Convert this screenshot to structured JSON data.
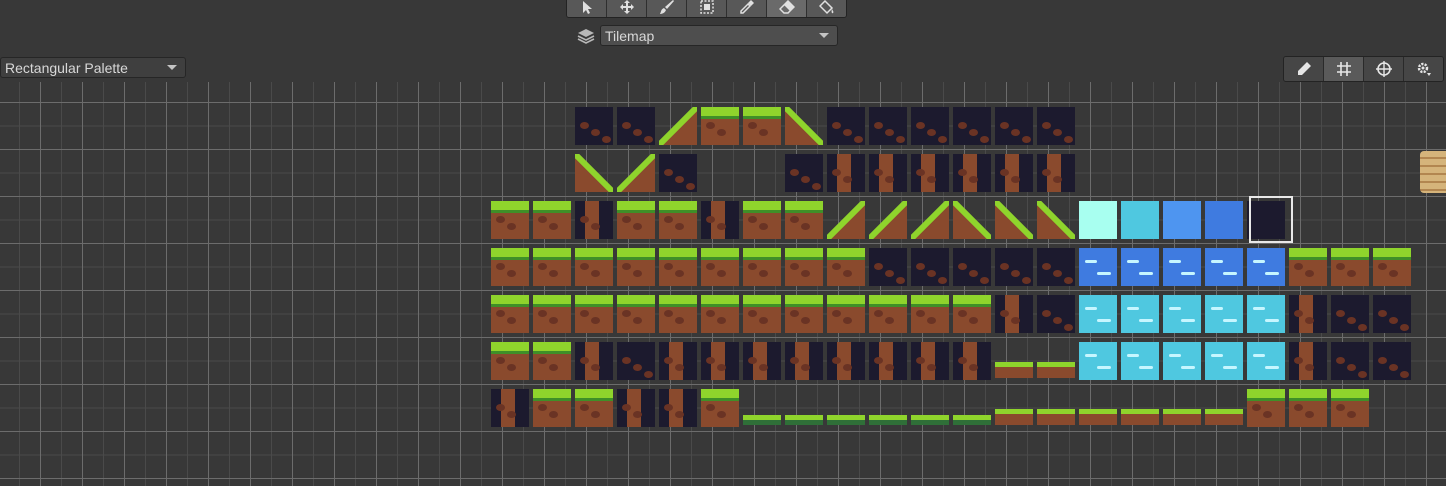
{
  "toolbar": {
    "tools": [
      {
        "name": "select-tool",
        "icon": "cursor-icon"
      },
      {
        "name": "move-tool",
        "icon": "move-icon"
      },
      {
        "name": "paint-brush-tool",
        "icon": "brush-icon"
      },
      {
        "name": "box-fill-tool",
        "icon": "box-fill-icon"
      },
      {
        "name": "picker-tool",
        "icon": "eyedropper-icon"
      },
      {
        "name": "eraser-tool",
        "icon": "eraser-icon",
        "active": true
      },
      {
        "name": "fill-tool",
        "icon": "paint-bucket-icon"
      }
    ]
  },
  "active_tilemap": {
    "value": "Tilemap"
  },
  "palette": {
    "value": "Rectangular Palette"
  },
  "palette_tools": [
    {
      "name": "edit-palette-button",
      "icon": "pencil-icon"
    },
    {
      "name": "toggle-grid-button",
      "icon": "grid-icon",
      "active": true
    },
    {
      "name": "gizmos-button",
      "icon": "target-icon"
    },
    {
      "name": "palette-settings-button",
      "icon": "gear-icon"
    }
  ],
  "colors": {
    "background": "#383838",
    "grass": "#8fd42c",
    "dirt": "#8a4a2d",
    "night": "#1c1a2e",
    "water_light": "#a8fff0",
    "water_cyan": "#4fc8e0",
    "water_mid": "#4e95f0",
    "water_deep": "#3f7be0"
  }
}
